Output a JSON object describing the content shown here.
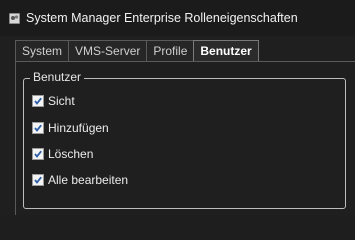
{
  "window": {
    "title": "System Manager Enterprise Rolleneigenschaften",
    "icon": "app-icon"
  },
  "tabs": [
    {
      "label": "System",
      "active": false
    },
    {
      "label": "VMS-Server",
      "active": false
    },
    {
      "label": "Profile",
      "active": false
    },
    {
      "label": "Benutzer",
      "active": true
    }
  ],
  "group": {
    "legend": "Benutzer",
    "options": [
      {
        "label": "Sicht",
        "checked": true
      },
      {
        "label": "Hinzufügen",
        "checked": true
      },
      {
        "label": "Löschen",
        "checked": true
      },
      {
        "label": "Alle bearbeiten",
        "checked": true
      }
    ]
  }
}
